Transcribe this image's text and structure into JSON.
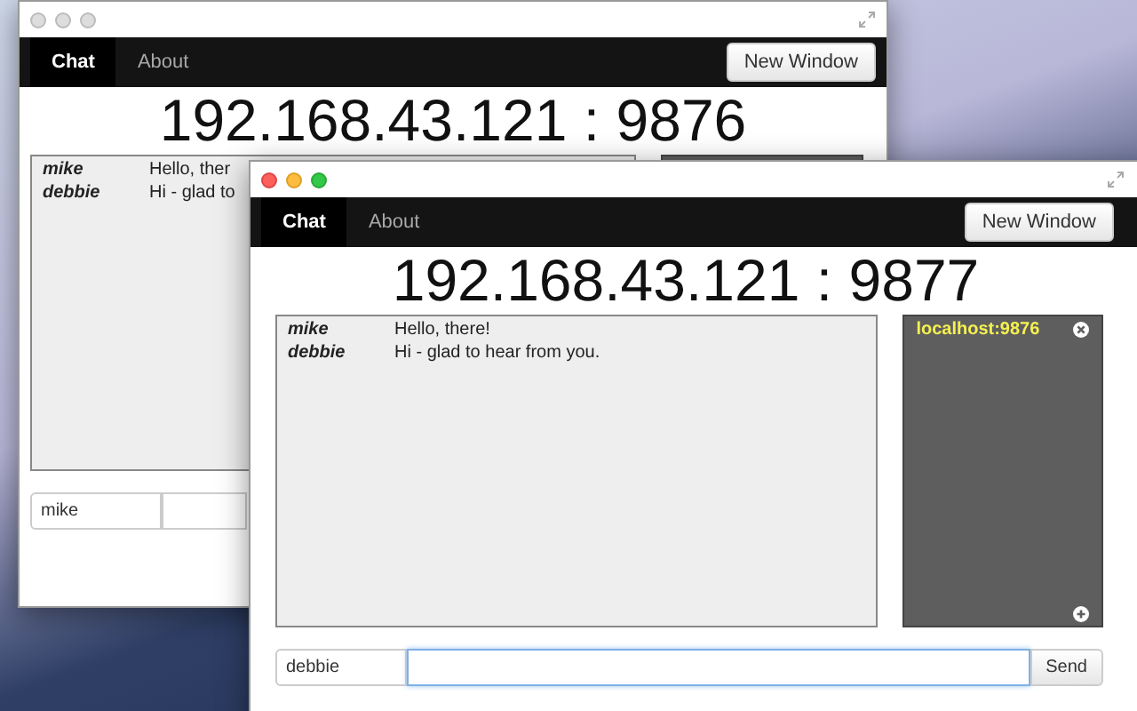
{
  "windows": [
    {
      "active": false,
      "tabs": [
        {
          "label": "Chat",
          "selected": true
        },
        {
          "label": "About",
          "selected": false
        }
      ],
      "new_window_button": "New Window",
      "address": "192.168.43.121 : 9876",
      "messages": [
        {
          "user": "mike",
          "text": "Hello, ther"
        },
        {
          "user": "debbie",
          "text": "Hi - glad to"
        }
      ],
      "name_field": {
        "value": "mike"
      },
      "message_field": {
        "focused": false
      }
    },
    {
      "active": true,
      "tabs": [
        {
          "label": "Chat",
          "selected": true
        },
        {
          "label": "About",
          "selected": false
        }
      ],
      "new_window_button": "New Window",
      "address": "192.168.43.121 : 9877",
      "messages": [
        {
          "user": "mike",
          "text": "Hello, there!"
        },
        {
          "user": "debbie",
          "text": "Hi - glad to hear from you."
        }
      ],
      "peers": [
        {
          "label": "localhost:9876"
        }
      ],
      "name_field": {
        "value": "debbie"
      },
      "message_field": {
        "focused": true
      },
      "send_button": "Send"
    }
  ]
}
